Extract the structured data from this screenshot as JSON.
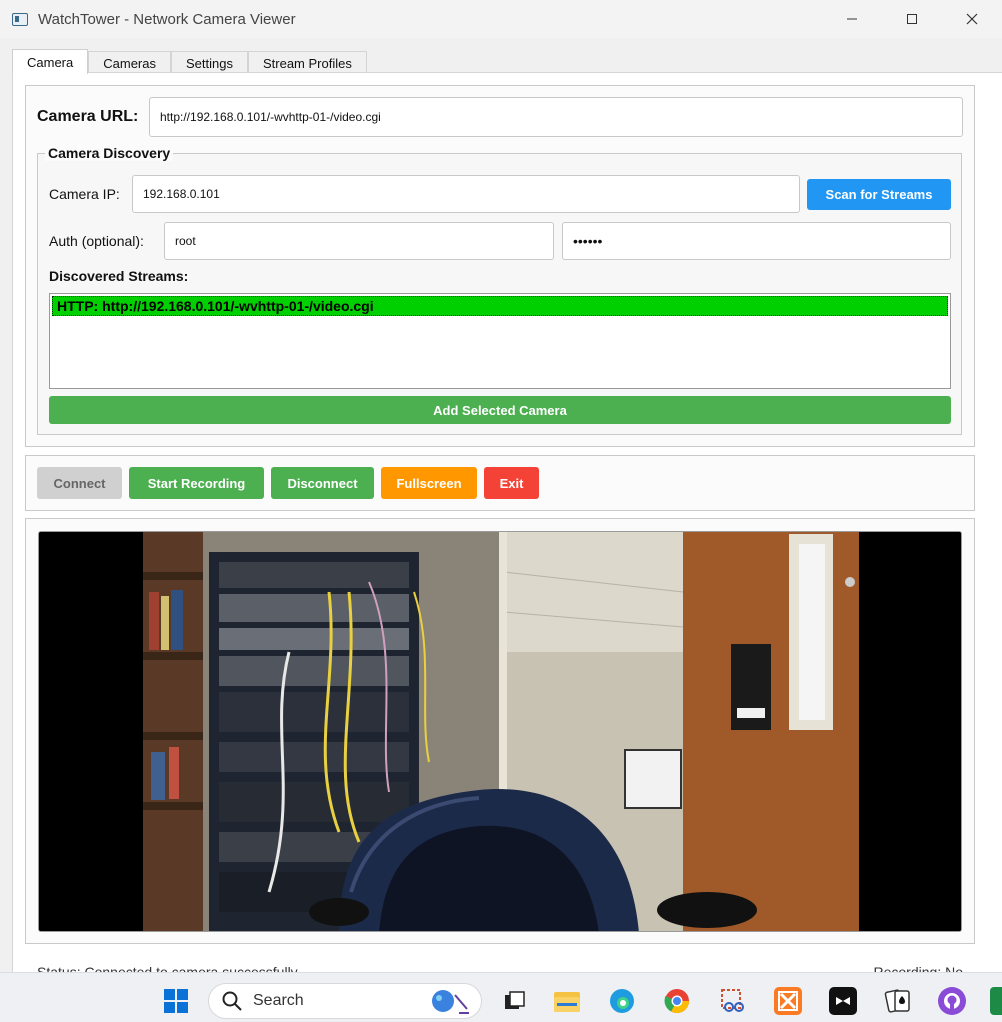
{
  "window": {
    "title": "WatchTower - Network Camera Viewer"
  },
  "tabs": [
    {
      "label": "Camera",
      "active": true
    },
    {
      "label": "Cameras",
      "active": false
    },
    {
      "label": "Settings",
      "active": false
    },
    {
      "label": "Stream Profiles",
      "active": false
    }
  ],
  "camera_url": {
    "label": "Camera URL:",
    "value": "http://192.168.0.101/-wvhttp-01-/video.cgi"
  },
  "discovery": {
    "title": "Camera Discovery",
    "ip_label": "Camera IP:",
    "ip_value": "192.168.0.101",
    "scan_button": "Scan for Streams",
    "auth_label": "Auth (optional):",
    "username": "root",
    "password": "••••••",
    "streams_label": "Discovered Streams:",
    "streams": [
      "HTTP: http://192.168.0.101/-wvhttp-01-/video.cgi"
    ],
    "add_button": "Add Selected Camera"
  },
  "controls": {
    "connect": "Connect",
    "start_recording": "Start Recording",
    "disconnect": "Disconnect",
    "fullscreen": "Fullscreen",
    "exit": "Exit"
  },
  "status": {
    "text": "Status: Connected to camera successfully",
    "recording": "Recording: No"
  },
  "taskbar": {
    "search_placeholder": "Search"
  },
  "colors": {
    "blue": "#2196f3",
    "green": "#4caf50",
    "orange": "#ff9800",
    "red": "#f44336",
    "disabled": "#d0d0d0",
    "selection": "#00d000"
  }
}
